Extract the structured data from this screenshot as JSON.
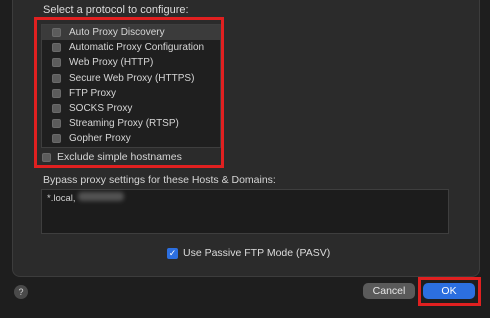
{
  "protocols": {
    "heading": "Select a protocol to configure:",
    "items": [
      {
        "label": "Auto Proxy Discovery",
        "selected": true
      },
      {
        "label": "Automatic Proxy Configuration"
      },
      {
        "label": "Web Proxy (HTTP)"
      },
      {
        "label": "Secure Web Proxy (HTTPS)"
      },
      {
        "label": "FTP Proxy"
      },
      {
        "label": "SOCKS Proxy"
      },
      {
        "label": "Streaming Proxy (RTSP)"
      },
      {
        "label": "Gopher Proxy"
      }
    ]
  },
  "exclude_simple_hostnames": {
    "label": "Exclude simple hostnames",
    "checked": false
  },
  "bypass": {
    "label": "Bypass proxy settings for these Hosts & Domains:",
    "value": "*.local,"
  },
  "passive_ftp": {
    "label": "Use Passive FTP Mode (PASV)",
    "checked": true
  },
  "buttons": {
    "help": "?",
    "cancel": "Cancel",
    "ok": "OK"
  },
  "colors": {
    "highlight": "#e02020",
    "accent": "#2c6fe0"
  }
}
